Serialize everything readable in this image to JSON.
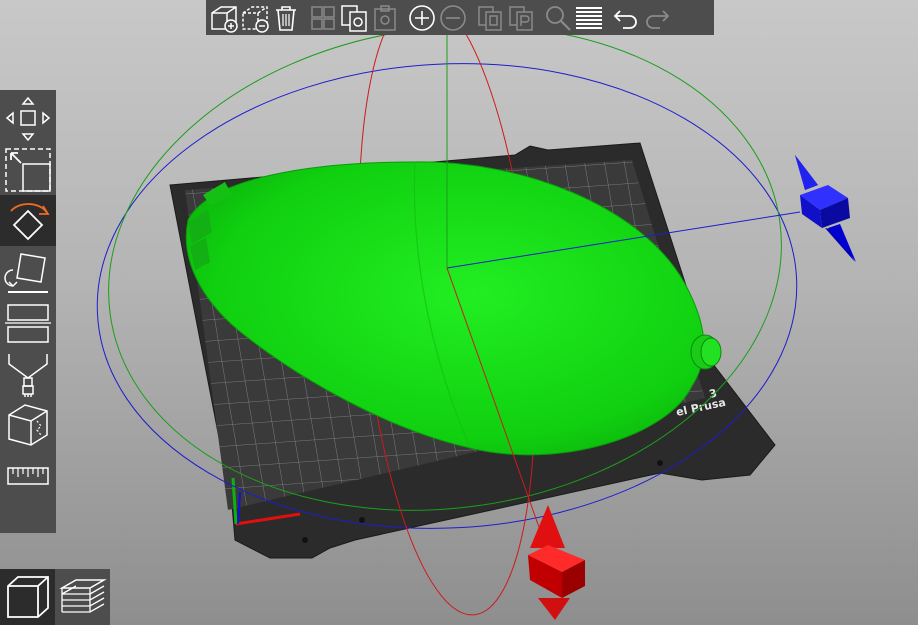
{
  "toolbar_top": {
    "buttons": [
      {
        "name": "add-button",
        "icon": "cube-plus-icon",
        "enabled": true
      },
      {
        "name": "delete-button",
        "icon": "cube-minus-icon",
        "enabled": true
      },
      {
        "name": "delete-all-button",
        "icon": "trash-icon",
        "enabled": true
      },
      {
        "name": "arrange-button",
        "icon": "arrange-icon",
        "enabled": false
      },
      {
        "name": "copy-button",
        "icon": "copy-icon",
        "enabled": true
      },
      {
        "name": "paste-button",
        "icon": "paste-icon",
        "enabled": false
      },
      {
        "name": "add-instance-button",
        "icon": "plus-circle-icon",
        "enabled": true
      },
      {
        "name": "remove-instance-button",
        "icon": "minus-circle-icon",
        "enabled": false
      },
      {
        "name": "split-objects-button",
        "icon": "split-objects-icon",
        "enabled": false
      },
      {
        "name": "split-parts-button",
        "icon": "split-parts-icon",
        "enabled": false
      },
      {
        "name": "search-button",
        "icon": "magnifier-icon",
        "enabled": false
      },
      {
        "name": "layers-editing-button",
        "icon": "layers-icon",
        "enabled": true
      },
      {
        "name": "undo-button",
        "icon": "undo-icon",
        "enabled": true
      },
      {
        "name": "redo-button",
        "icon": "redo-icon",
        "enabled": false
      }
    ]
  },
  "toolbar_left": {
    "tools": [
      {
        "name": "move-tool",
        "icon": "move-arrows-icon",
        "active": false
      },
      {
        "name": "scale-tool",
        "icon": "scale-icon",
        "active": false
      },
      {
        "name": "rotate-tool",
        "icon": "rotate-icon",
        "active": true
      },
      {
        "name": "place-on-face-tool",
        "icon": "place-on-face-icon",
        "active": false
      },
      {
        "name": "cut-tool",
        "icon": "cut-icon",
        "active": false
      },
      {
        "name": "supports-painting-tool",
        "icon": "supports-paint-icon",
        "active": false
      },
      {
        "name": "seam-painting-tool",
        "icon": "seam-paint-icon",
        "active": false
      },
      {
        "name": "measure-tool",
        "icon": "ruler-icon",
        "active": false
      }
    ]
  },
  "view_switch": {
    "items": [
      {
        "name": "3d-view-button",
        "icon": "cube-view-icon",
        "active": true
      },
      {
        "name": "preview-button",
        "icon": "layers-preview-icon",
        "active": false
      }
    ]
  },
  "bed": {
    "label_line1": "3",
    "label_line2": "el Prusa"
  },
  "colors": {
    "toolbar_bg": "#4d4d4d",
    "toolbar_active": "#2c2c2c",
    "icon_enabled": "#ffffff",
    "icon_disabled": "#8a8a8a",
    "accent_orange": "#ed6b21",
    "model_green": "#1ee41e",
    "axis_x_red": "#e01010",
    "axis_y_green": "#10b010",
    "axis_z_blue": "#1010e0",
    "bed_bg": "#2b2b2b",
    "grid_line": "#9a9a9a"
  }
}
